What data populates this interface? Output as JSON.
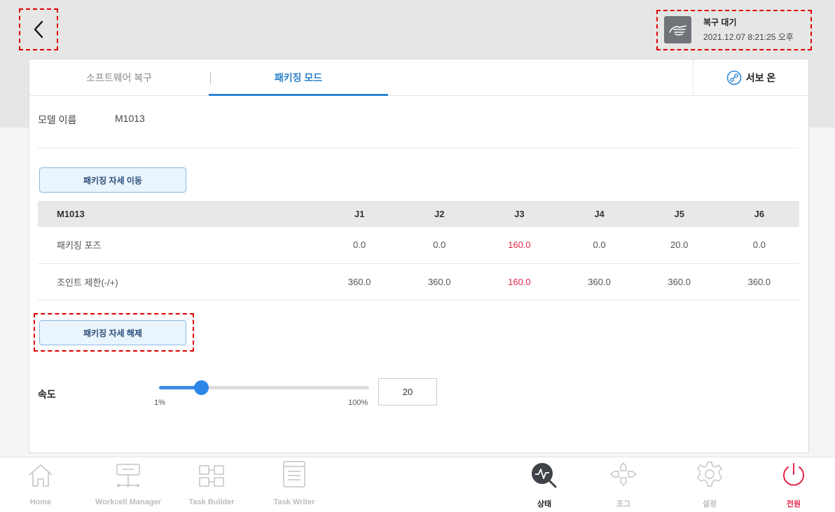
{
  "header": {
    "status_title": "복구 대기",
    "status_time": "2021.12.07 8:21:25 오후",
    "status_icon": "hand-icon"
  },
  "tabs": [
    {
      "label": "소프트웨어 복구",
      "active": false
    },
    {
      "label": "패키징 모드",
      "active": true
    }
  ],
  "servo": {
    "label": "서보 온",
    "icon": "servo-icon"
  },
  "model": {
    "label": "모델 이름",
    "value": "M1013"
  },
  "buttons": {
    "move_pose": "패키징 자세 이동",
    "release_pose": "패키징 자세 해제"
  },
  "table": {
    "headers": [
      "M1013",
      "J1",
      "J2",
      "J3",
      "J4",
      "J5",
      "J6"
    ],
    "rows": [
      {
        "label": "패키징 포즈",
        "values": [
          "0.0",
          "0.0",
          "160.0",
          "0.0",
          "20.0",
          "0.0"
        ]
      },
      {
        "label": "조인트 제한(-/+)",
        "values": [
          "360.0",
          "360.0",
          "160.0",
          "360.0",
          "360.0",
          "360.0"
        ]
      }
    ],
    "highlight_color": "#e0264a"
  },
  "speed": {
    "label": "속도",
    "min_label": "1%",
    "max_label": "100%",
    "value": "20",
    "slider_fraction": 0.2
  },
  "bottom_nav": [
    {
      "label": "Home",
      "icon": "home-icon"
    },
    {
      "label": "Workcell Manager",
      "icon": "workcell-icon"
    },
    {
      "label": "Task Builder",
      "icon": "task-builder-icon"
    },
    {
      "label": "Task Writer",
      "icon": "task-writer-icon"
    },
    {
      "label": "상태",
      "icon": "status-monitor-icon",
      "active": true
    },
    {
      "label": "조그",
      "icon": "jog-icon"
    },
    {
      "label": "설정",
      "icon": "gear-icon"
    },
    {
      "label": "전원",
      "icon": "power-icon"
    }
  ],
  "colors": {
    "accent": "#2e86d4",
    "danger": "#e0264a",
    "nav_disabled": "#bdbdbd"
  }
}
